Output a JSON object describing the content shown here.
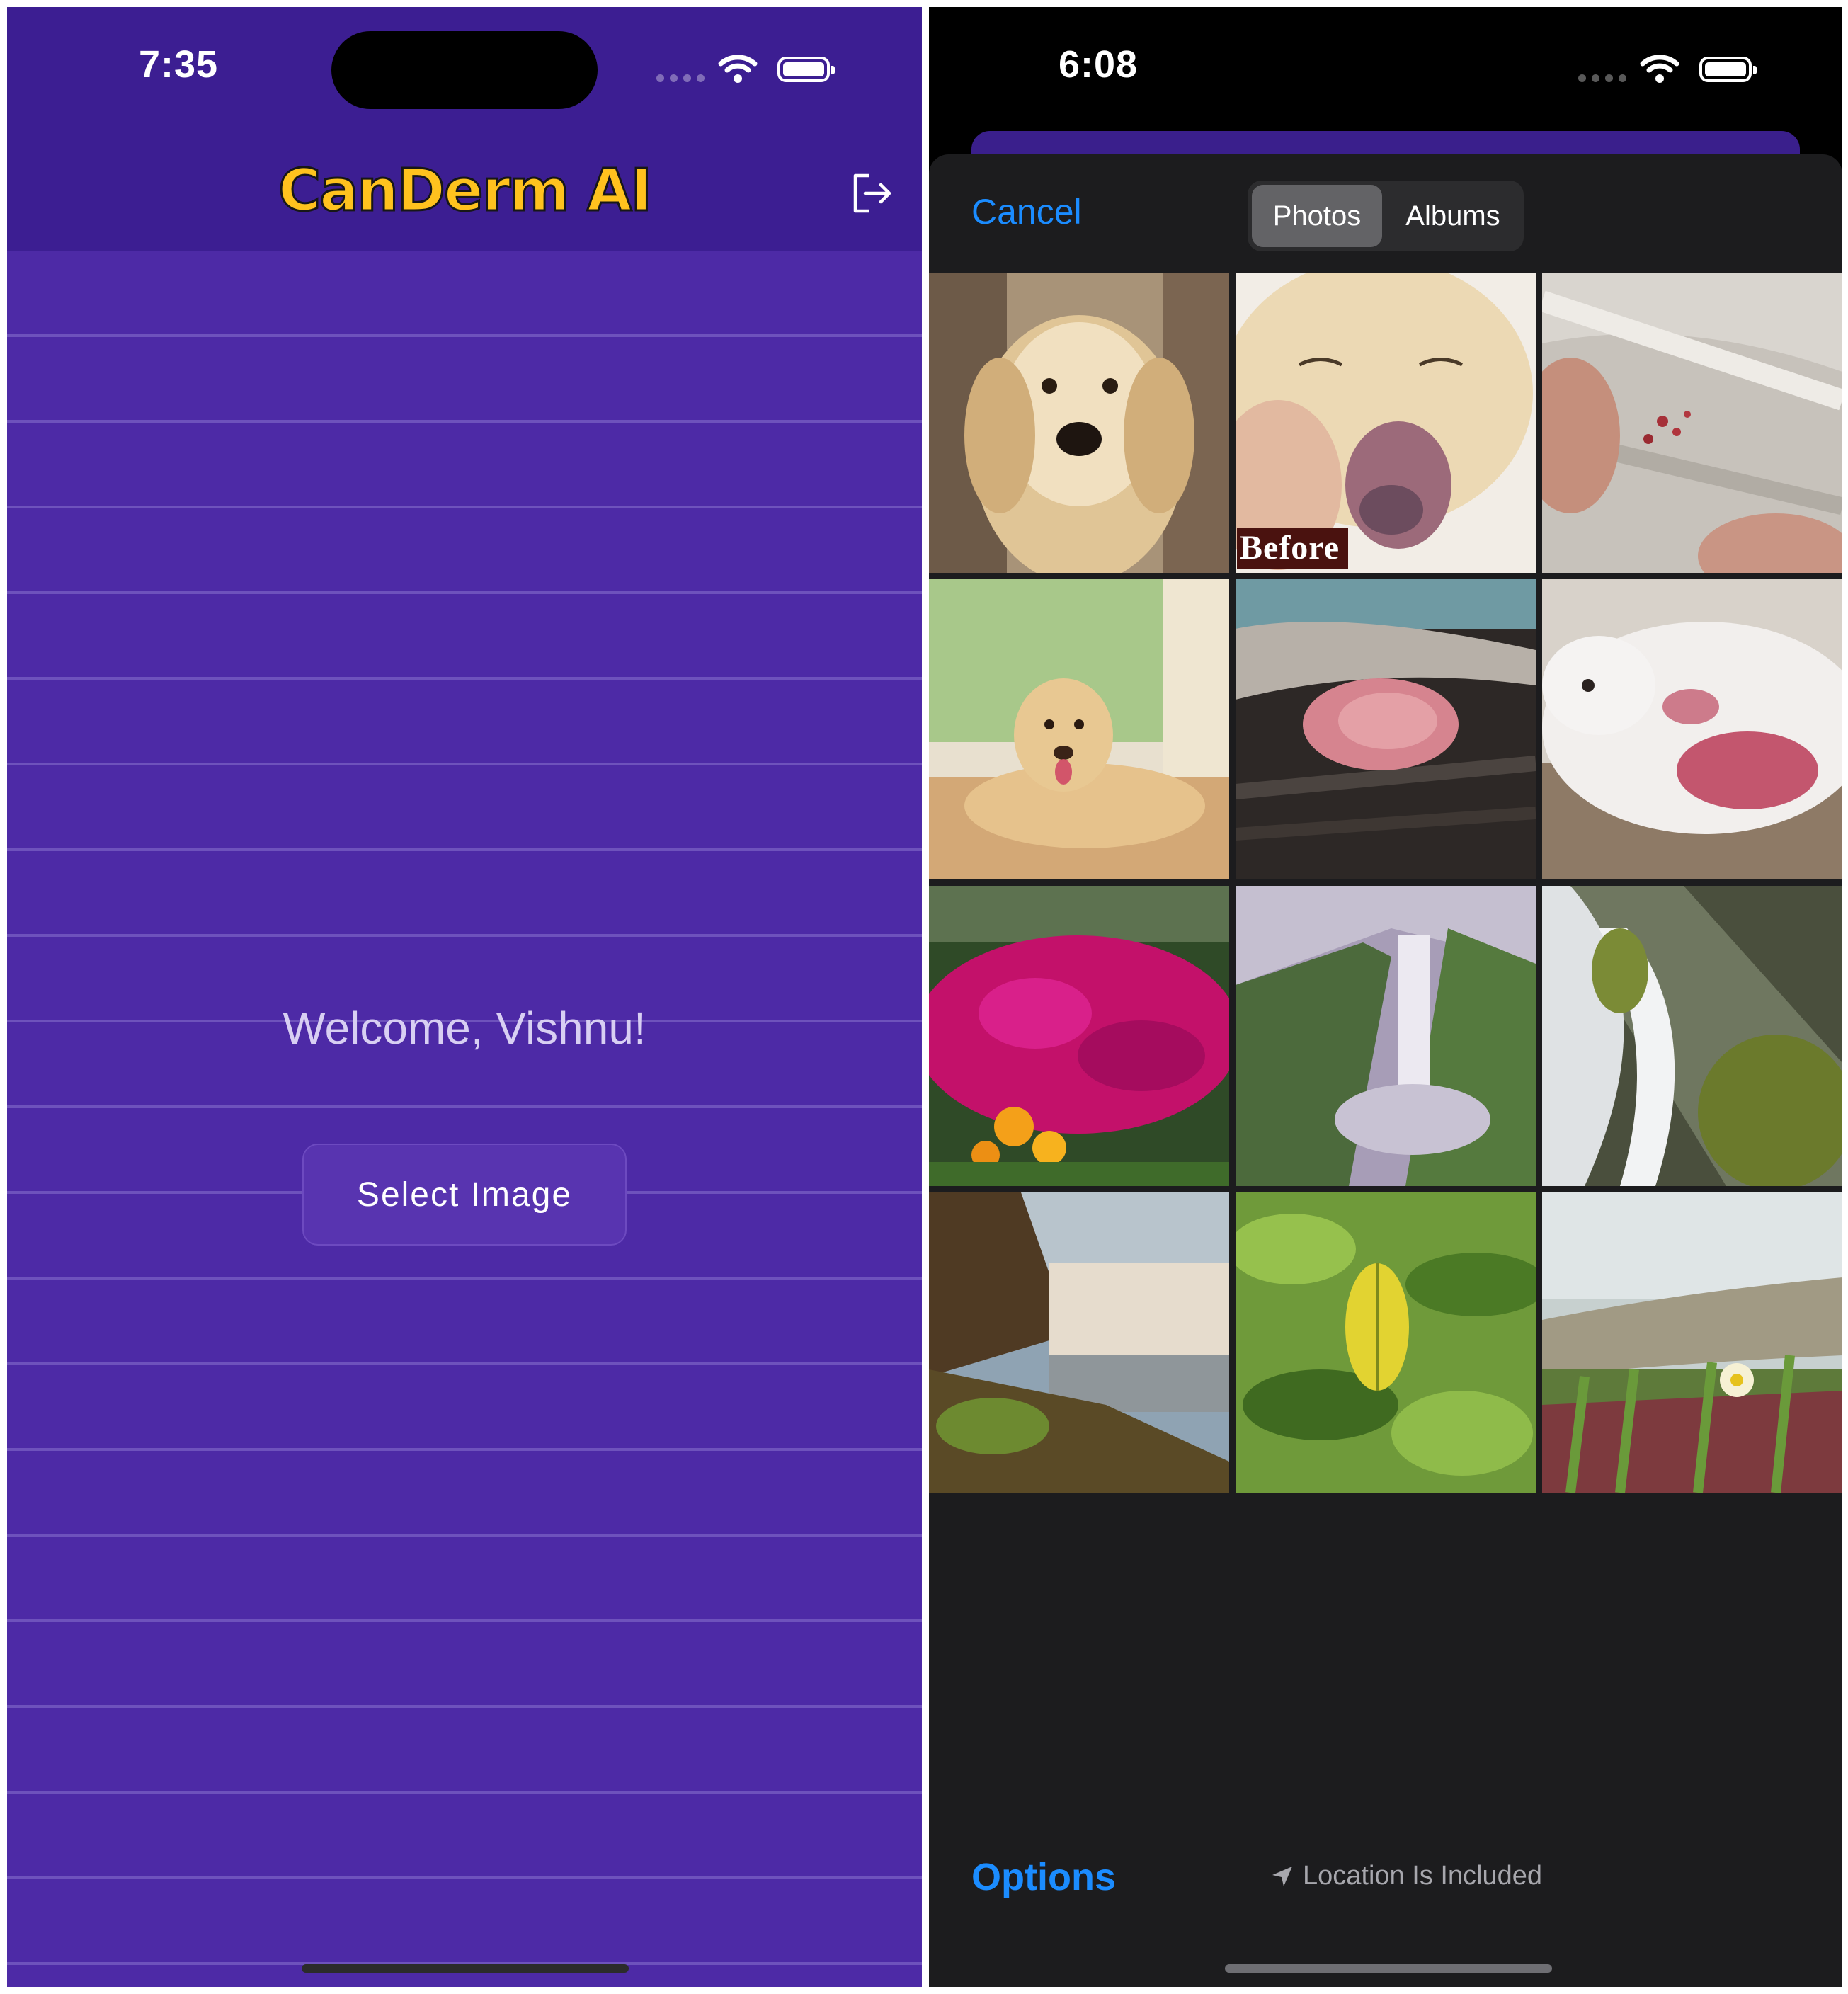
{
  "left_screen": {
    "status_bar": {
      "time": "7:35"
    },
    "header": {
      "title": "CanDerm AI",
      "logout_icon": "logout-icon"
    },
    "welcome_text": "Welcome, Vishnu!",
    "select_button_label": "Select Image",
    "colors": {
      "header_bg": "#3c1e92",
      "body_bg": "#4d2aa6",
      "logo": "#ffc21e"
    }
  },
  "right_screen": {
    "status_bar": {
      "time": "6:08"
    },
    "picker": {
      "cancel_label": "Cancel",
      "segments": [
        "Photos",
        "Albums"
      ],
      "selected_segment": "Photos",
      "photos": [
        {
          "name": "golden-retriever-portrait"
        },
        {
          "name": "dog-nose-lesion",
          "caption": "Before"
        },
        {
          "name": "skin-irritation-fur"
        },
        {
          "name": "labrador-puppy-lying"
        },
        {
          "name": "pink-skin-patch"
        },
        {
          "name": "white-dog-skin-rash"
        },
        {
          "name": "magenta-flowers"
        },
        {
          "name": "waterfall-valley"
        },
        {
          "name": "waterfall-rocks"
        },
        {
          "name": "waterfall-coast"
        },
        {
          "name": "green-leaves"
        },
        {
          "name": "beach-grass-flower"
        }
      ],
      "options_label": "Options",
      "location_label": "Location Is Included"
    },
    "colors": {
      "accent": "#1b8cff",
      "sheet_bg": "#1c1c1e"
    }
  }
}
